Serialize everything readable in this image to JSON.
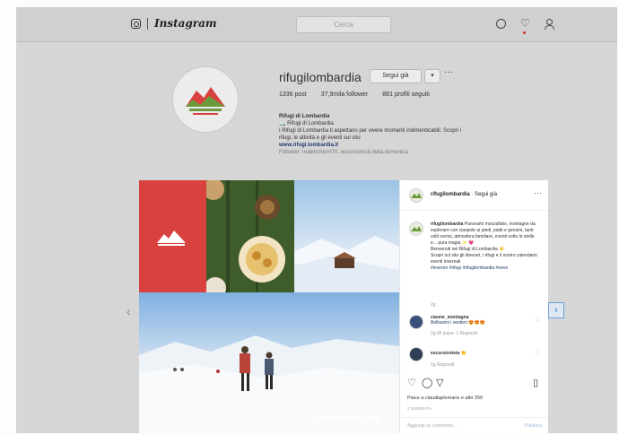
{
  "app": {
    "brand": "Instagram"
  },
  "search": {
    "placeholder": "Cerca"
  },
  "profile": {
    "username": "rifugilombardia",
    "follow_label": "Segui già",
    "dropdown_label": "▾",
    "more_label": "···",
    "stats": {
      "posts": "1336 post",
      "followers": "37,9mila follower",
      "following": "881 profili seguiti"
    },
    "bio_name": "Rifugi di Lombardia",
    "bio_line1": "🏔️ Rifugi di Lombardia",
    "bio_line2": "I Rifugi di Lombardia ti aspettano per vivere momenti indimenticabili. Scopri i",
    "bio_line3": "rifugi, le attività e gli eventi sul sito",
    "bio_link": "www.rifugi.lombardia.it",
    "bio_followed": "Follower: malenchiorri70, escursionisti.della.domenica"
  },
  "post": {
    "header_user": "rifugilombardia",
    "header_follow": "· Segui già",
    "header_more": "···",
    "caption_user": "rifugilombardia",
    "caption_text": "Panorami mozzafiato, montagne da esplorare con ciaspole ai piedi, piatti e genuini, tanti volti sorrisi, atmosfera familiare, eventi sotto le stelle e... pura magia ✨ 💗",
    "caption_welcome": "Benvenuti nei Rifugi di Lombardia ☀️",
    "caption_more": "Scopri sul sito gli itinerari, i rifugi e il nostro calendario eventi invernali",
    "caption_tags": "#inverno #rifugi #rifugilombardia #neve",
    "caption_time": "2g",
    "comments": [
      {
        "user": "ciaone_montagna",
        "text": "Bellissimi i sentieri 😍😍😍",
        "meta": "2g  Mi piace: 1  Rispondi"
      },
      {
        "user": "escursionista",
        "text": "👏",
        "meta": "2g  Rispondi"
      }
    ],
    "likes": "Piace a claudiaplemane e altri 250",
    "date": "2 GIORNI FA",
    "comment_placeholder": "Aggiungi un commento...",
    "publish_label": "Pubblica",
    "image_caption": "Inverno nei rifugi"
  },
  "nav": {
    "prev": "‹",
    "next": "›"
  }
}
